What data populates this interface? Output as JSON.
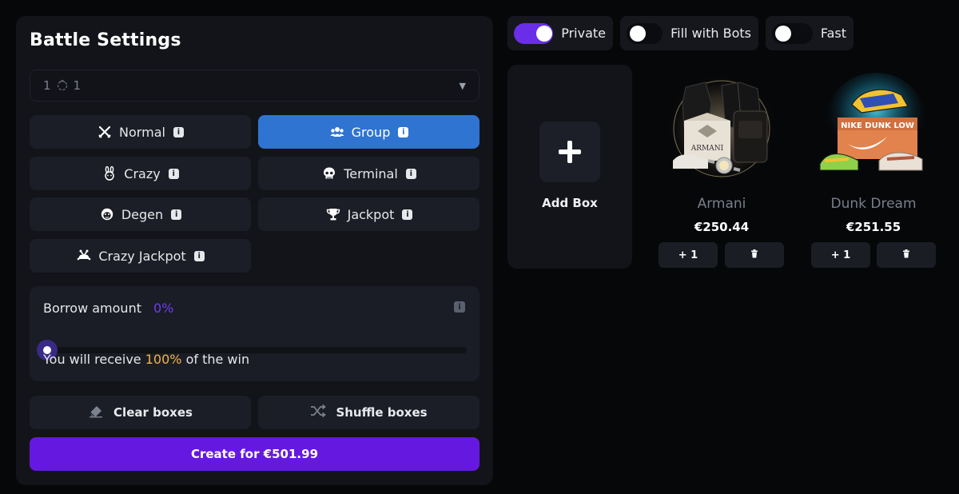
{
  "settings": {
    "title": "Battle Settings",
    "mode": {
      "left_value": "1",
      "right_value": "1"
    },
    "modes": [
      {
        "label": "Normal",
        "icon": "swords-icon"
      },
      {
        "label": "Group",
        "icon": "users-icon",
        "active": true
      },
      {
        "label": "Crazy",
        "icon": "bunny-icon"
      },
      {
        "label": "Terminal",
        "icon": "skull-icon"
      },
      {
        "label": "Degen",
        "icon": "monkey-icon"
      },
      {
        "label": "Jackpot",
        "icon": "trophy-icon"
      },
      {
        "label": "Crazy Jackpot",
        "icon": "jester-icon"
      }
    ],
    "borrow": {
      "label": "Borrow amount",
      "percent": "0%",
      "value": 0,
      "receive_prefix": "You will receive",
      "receive_value": "100%",
      "receive_suffix": "of the win"
    },
    "clear_label": "Clear boxes",
    "shuffle_label": "Shuffle boxes",
    "create_label": "Create for €501.99"
  },
  "toggles": [
    {
      "label": "Private",
      "on": true
    },
    {
      "label": "Fill with Bots",
      "on": false
    },
    {
      "label": "Fast",
      "on": false
    }
  ],
  "add_box_label": "Add Box",
  "boxes": [
    {
      "name": "Armani",
      "price": "€250.44",
      "add_label": "+ 1"
    },
    {
      "name": "Dunk Dream",
      "price": "€251.55",
      "add_label": "+ 1"
    }
  ],
  "colors": {
    "accent_purple": "#6519e0",
    "active_blue": "#2f74d0",
    "highlight_orange": "#f2b34a"
  }
}
